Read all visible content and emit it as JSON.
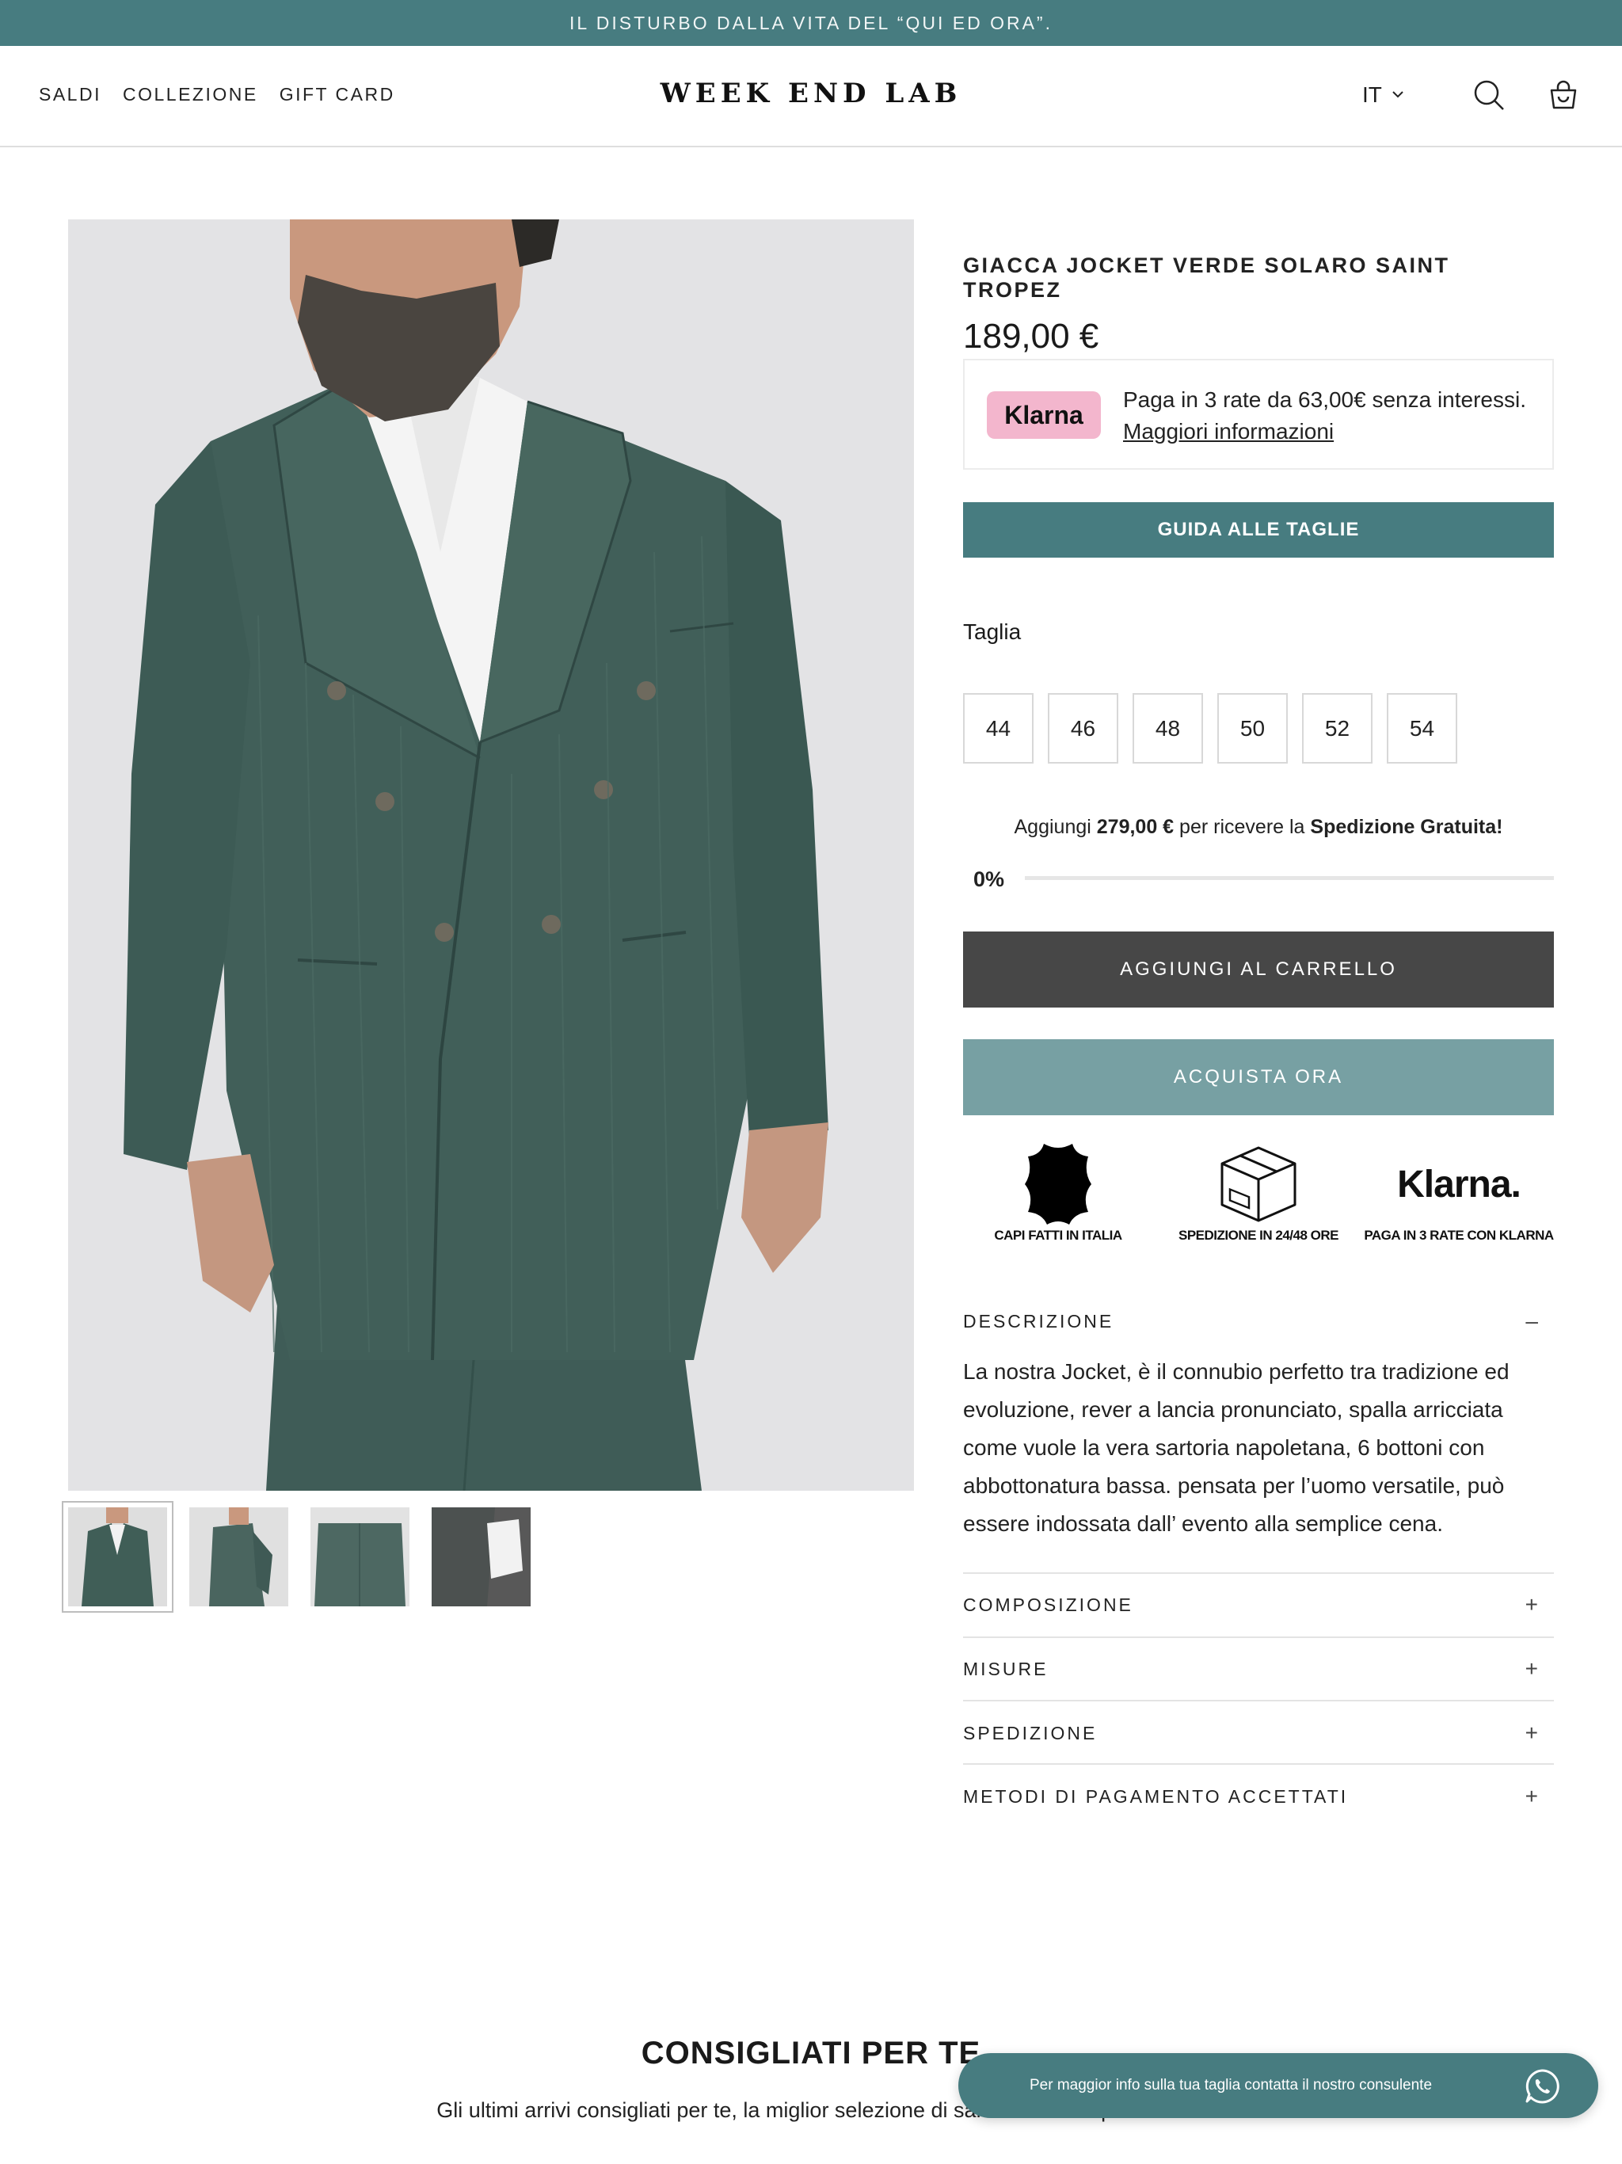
{
  "announcement": "IL DISTURBO DALLA VITA DEL “QUI ED ORA”.",
  "nav": {
    "items": [
      "SALDI",
      "COLLEZIONE",
      "GIFT CARD"
    ]
  },
  "brand": "WEEK END LAB",
  "header": {
    "language": "IT",
    "icons": [
      "search-icon",
      "cart-icon",
      "chevron-down-icon"
    ]
  },
  "product": {
    "title": "GIACCA JOCKET VERDE SOLARO SAINT TROPEZ",
    "price": "189,00 €",
    "klarna": {
      "badge": "Klarna",
      "text": "Paga in 3 rate da 63,00€ senza interessi.",
      "link": "Maggiori informazioni"
    },
    "size_guide_label": "GUIDA ALLE TAGLIE",
    "size_label": "Taglia",
    "sizes": [
      "44",
      "46",
      "48",
      "50",
      "52",
      "54"
    ],
    "shipping": {
      "prefix": "Aggiungi",
      "amount": "279,00 €",
      "middle": "per ricevere la",
      "highlight": "Spedizione Gratuita!",
      "progress_label": "0%",
      "progress_value": 0
    },
    "add_to_cart": "AGGIUNGI AL CARRELLO",
    "buy_now": "ACQUISTA ORA",
    "badges": [
      {
        "icon": "leather-icon",
        "label": "CAPI FATTI IN ITALIA"
      },
      {
        "icon": "box-icon",
        "label": "SPEDIZIONE IN 24/48 ORE"
      },
      {
        "icon": "klarna-logo",
        "logo_text": "Klarna.",
        "label": "PAGA IN 3 RATE CON KLARNA"
      }
    ],
    "accordion": [
      {
        "title": "DESCRIZIONE",
        "sign": "–",
        "open": true
      },
      {
        "title": "COMPOSIZIONE",
        "sign": "+"
      },
      {
        "title": "MISURE",
        "sign": "+"
      },
      {
        "title": "SPEDIZIONE",
        "sign": "+"
      },
      {
        "title": "METODI DI PAGAMENTO ACCETTATI",
        "sign": "+"
      }
    ],
    "description": "La nostra Jocket, è il connubio perfetto tra tradizione ed evoluzione, rever a lancia pronunciato, spalla arricciata come vuole la vera sartoria napoletana, 6 bottoni con abbottonatura bassa. pensata per l’uomo versatile, può essere indossata dall’ evento alla semplice cena."
  },
  "recommended": {
    "title": "CONSIGLIATI PER TE",
    "subtitle": "Gli ultimi arrivi consigliati per te, la miglior selezione di sartoria contemporanea."
  },
  "chat": {
    "text": "Per maggior info sulla tua taglia contatta il nostro consulente",
    "icon": "whatsapp-icon"
  },
  "colors": {
    "accent": "#477c80",
    "accent_light": "#77a0a3",
    "cart_button": "#474747",
    "suit": "#405e57",
    "klarna_pink": "#f3b6cd"
  }
}
